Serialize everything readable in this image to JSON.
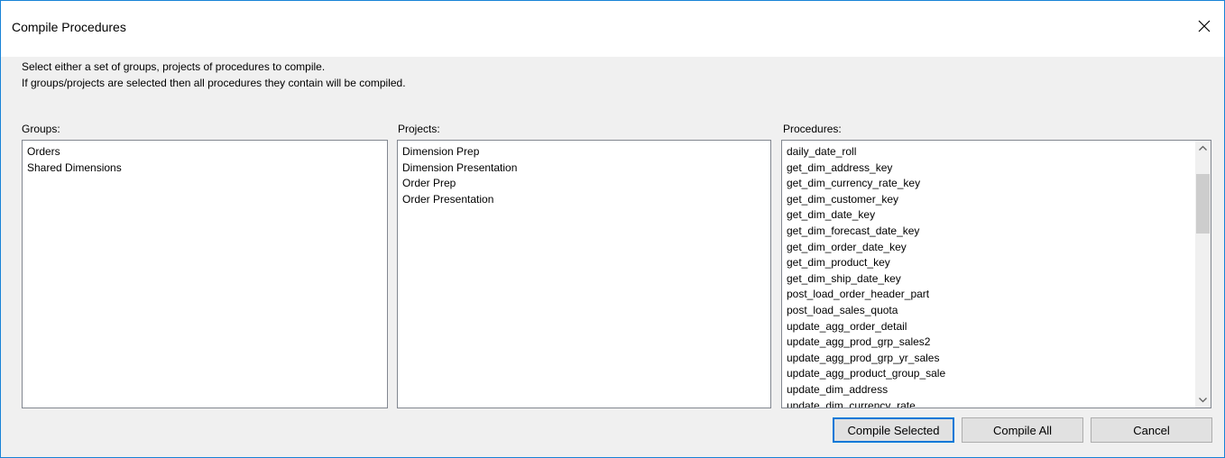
{
  "window": {
    "title": "Compile Procedures",
    "close_icon": "close-icon"
  },
  "description": {
    "line1": "Select either a set of groups, projects of procedures to compile.",
    "line2": "If groups/projects are selected then all procedures they contain will be compiled."
  },
  "groups": {
    "label": "Groups:",
    "items": [
      "Orders",
      "Shared Dimensions"
    ]
  },
  "projects": {
    "label": "Projects:",
    "items": [
      "Dimension Prep",
      "Dimension Presentation",
      "Order Prep",
      "Order Presentation"
    ]
  },
  "procedures": {
    "label": "Procedures:",
    "items": [
      "daily_date_roll",
      "get_dim_address_key",
      "get_dim_currency_rate_key",
      "get_dim_customer_key",
      "get_dim_date_key",
      "get_dim_forecast_date_key",
      "get_dim_order_date_key",
      "get_dim_product_key",
      "get_dim_ship_date_key",
      "post_load_order_header_part",
      "post_load_sales_quota",
      "update_agg_order_detail",
      "update_agg_prod_grp_sales2",
      "update_agg_prod_grp_yr_sales",
      "update_agg_product_group_sale",
      "update_dim_address",
      "update_dim_currency_rate"
    ],
    "scroll_position": 0.1
  },
  "buttons": {
    "compile_selected": "Compile Selected",
    "compile_all": "Compile All",
    "cancel": "Cancel"
  },
  "colors": {
    "accent": "#0078d7",
    "window_border": "#1883d7",
    "dialog_bg": "#f0f0f0"
  }
}
